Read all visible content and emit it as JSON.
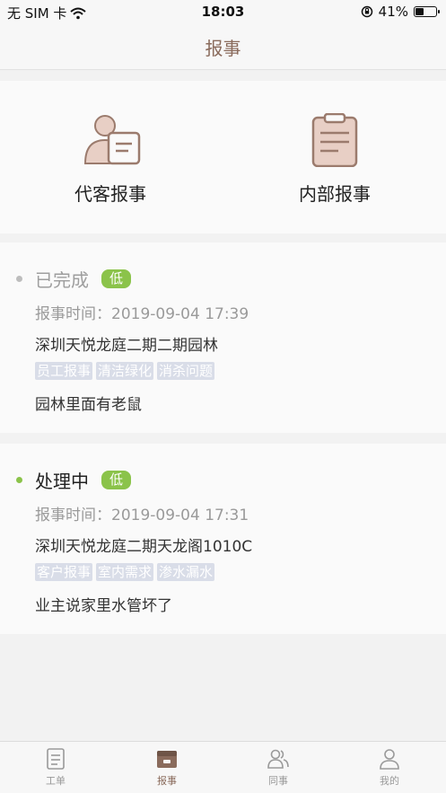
{
  "status_bar": {
    "carrier": "无 SIM 卡",
    "time": "18:03",
    "battery": "41%",
    "battery_level": 0.41
  },
  "header": {
    "title": "报事"
  },
  "entries": [
    {
      "label": "代客报事",
      "icon": "person-form-icon"
    },
    {
      "label": "内部报事",
      "icon": "clipboard-icon"
    }
  ],
  "reports": [
    {
      "status": "已完成",
      "status_color": "#9e9e9e",
      "dot_color": "#bdbdbd",
      "priority": "低",
      "time": "报事时间：2019-09-04 17:39",
      "location": "深圳天悦龙庭二期二期园林",
      "tags": [
        "员工报事",
        "清洁绿化",
        "消杀问题"
      ],
      "description": "园林里面有老鼠"
    },
    {
      "status": "处理中",
      "status_color": "#222222",
      "dot_color": "#8bc34a",
      "priority": "低",
      "time": "报事时间：2019-09-04 17:31",
      "location": "深圳天悦龙庭二期天龙阁1010C",
      "tags": [
        "客户报事",
        "室内需求",
        "渗水漏水"
      ],
      "description": "业主说家里水管坏了"
    }
  ],
  "tabbar": {
    "items": [
      {
        "label": "工单",
        "icon": "document-icon"
      },
      {
        "label": "报事",
        "icon": "report-icon"
      },
      {
        "label": "同事",
        "icon": "colleagues-icon"
      },
      {
        "label": "我的",
        "icon": "profile-icon"
      }
    ],
    "active": 1
  },
  "colors": {
    "accent": "#8a6b5c",
    "icon_fill": "#e8cfc5",
    "icon_stroke": "#9b7b6d",
    "priority_low": "#8bc34a",
    "tag_bg": "#d9dde8"
  }
}
